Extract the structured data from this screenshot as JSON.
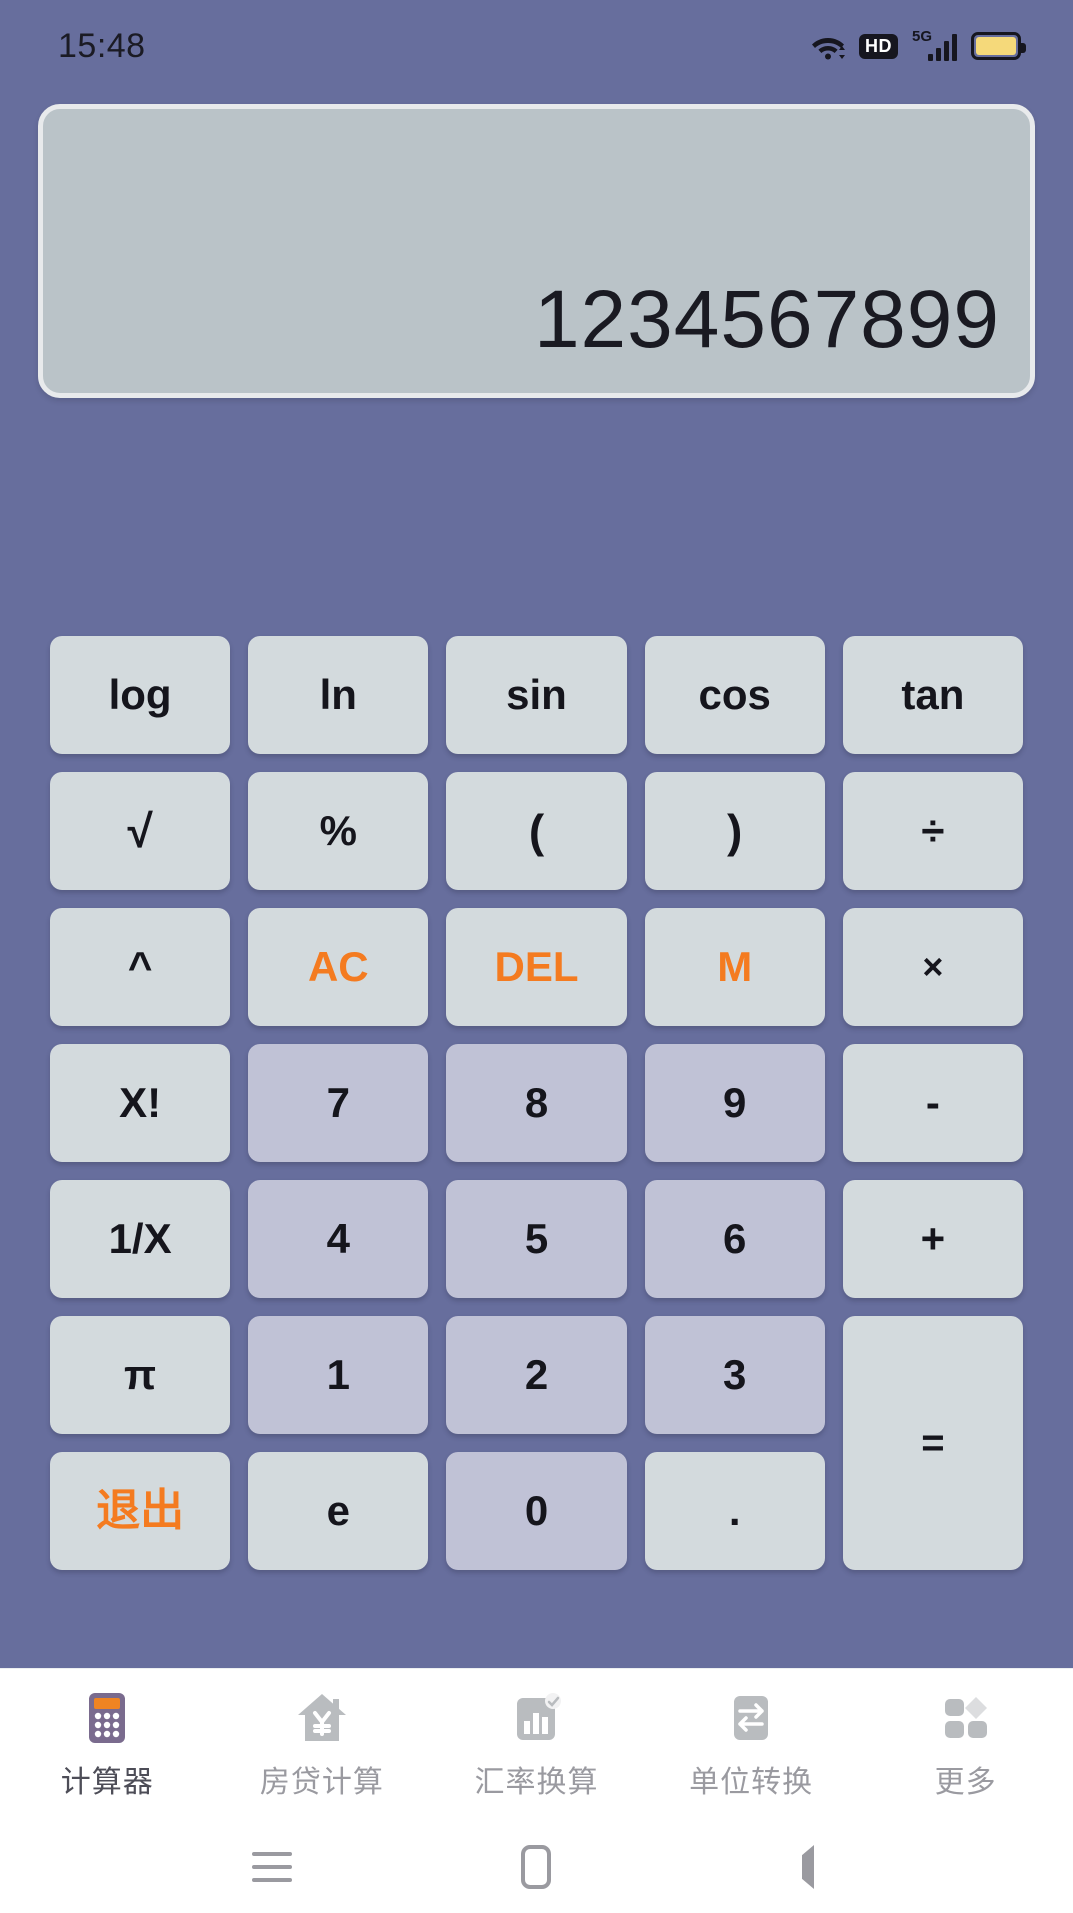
{
  "status_bar": {
    "time": "15:48",
    "icons": [
      "wifi-icon",
      "hd-icon",
      "5g-signal-icon",
      "battery-icon"
    ],
    "hd_label": "HD",
    "network_label": "5G"
  },
  "display": {
    "value": "1234567899"
  },
  "colors": {
    "background": "#676e9d",
    "function_key": "#d3dadd",
    "number_key": "#c0c2d6",
    "accent": "#f47b20",
    "display_panel": "#bac3c8",
    "text": "#15151c"
  },
  "keypad": {
    "rows": [
      [
        {
          "label": "log",
          "name": "key-log",
          "type": "func"
        },
        {
          "label": "ln",
          "name": "key-ln",
          "type": "func"
        },
        {
          "label": "sin",
          "name": "key-sin",
          "type": "func"
        },
        {
          "label": "cos",
          "name": "key-cos",
          "type": "func"
        },
        {
          "label": "tan",
          "name": "key-tan",
          "type": "func"
        }
      ],
      [
        {
          "label": "√",
          "name": "key-sqrt",
          "type": "func"
        },
        {
          "label": "%",
          "name": "key-percent",
          "type": "func"
        },
        {
          "label": "(",
          "name": "key-paren-open",
          "type": "func"
        },
        {
          "label": ")",
          "name": "key-paren-close",
          "type": "func"
        },
        {
          "label": "÷",
          "name": "key-divide",
          "type": "func"
        }
      ],
      [
        {
          "label": "^",
          "name": "key-power",
          "type": "func"
        },
        {
          "label": "AC",
          "name": "key-ac",
          "type": "accent"
        },
        {
          "label": "DEL",
          "name": "key-del",
          "type": "accent"
        },
        {
          "label": "M",
          "name": "key-memory",
          "type": "accent"
        },
        {
          "label": "×",
          "name": "key-multiply",
          "type": "func"
        }
      ],
      [
        {
          "label": "X!",
          "name": "key-factorial",
          "type": "func"
        },
        {
          "label": "7",
          "name": "key-7",
          "type": "num"
        },
        {
          "label": "8",
          "name": "key-8",
          "type": "num"
        },
        {
          "label": "9",
          "name": "key-9",
          "type": "num"
        },
        {
          "label": "-",
          "name": "key-minus",
          "type": "func"
        }
      ],
      [
        {
          "label": "1/X",
          "name": "key-reciprocal",
          "type": "func"
        },
        {
          "label": "4",
          "name": "key-4",
          "type": "num"
        },
        {
          "label": "5",
          "name": "key-5",
          "type": "num"
        },
        {
          "label": "6",
          "name": "key-6",
          "type": "num"
        },
        {
          "label": "+",
          "name": "key-plus",
          "type": "func"
        }
      ],
      [
        {
          "label": "π",
          "name": "key-pi",
          "type": "func"
        },
        {
          "label": "1",
          "name": "key-1",
          "type": "num"
        },
        {
          "label": "2",
          "name": "key-2",
          "type": "num"
        },
        {
          "label": "3",
          "name": "key-3",
          "type": "num"
        },
        {
          "label": "=",
          "name": "key-equals",
          "type": "equals"
        }
      ],
      [
        {
          "label": "退出",
          "name": "key-exit",
          "type": "accent-cjk"
        },
        {
          "label": "e",
          "name": "key-e",
          "type": "func"
        },
        {
          "label": "0",
          "name": "key-0",
          "type": "num"
        },
        {
          "label": ".",
          "name": "key-decimal",
          "type": "func"
        }
      ]
    ]
  },
  "tabbar": {
    "items": [
      {
        "label": "计算器",
        "icon": "calculator-icon",
        "active": true
      },
      {
        "label": "房贷计算",
        "icon": "house-yen-icon",
        "active": false
      },
      {
        "label": "汇率换算",
        "icon": "bar-chart-icon",
        "active": false
      },
      {
        "label": "单位转换",
        "icon": "swap-arrows-icon",
        "active": false
      },
      {
        "label": "更多",
        "icon": "grid-more-icon",
        "active": false
      }
    ]
  },
  "navbar": {
    "items": [
      {
        "name": "recents-button",
        "icon": "menu-lines-icon"
      },
      {
        "name": "home-button",
        "icon": "home-rect-icon"
      },
      {
        "name": "back-button",
        "icon": "back-triangle-icon"
      }
    ]
  }
}
